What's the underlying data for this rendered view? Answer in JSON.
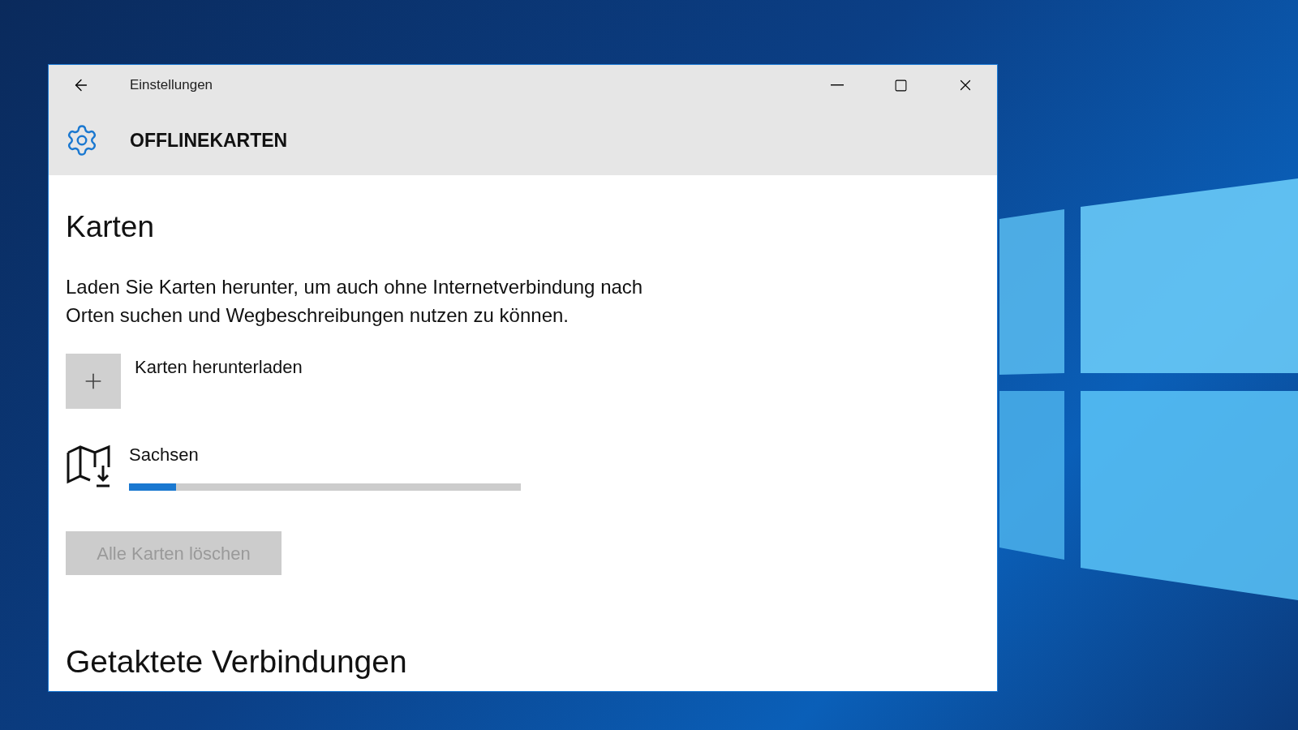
{
  "window": {
    "title": "Einstellungen",
    "page_title": "OFFLINEKARTEN"
  },
  "section": {
    "heading": "Karten",
    "description_lines": [
      "Laden Sie Karten herunter, um auch ohne Internetverbindung nach",
      "Orten suchen und Wegbeschreibungen nutzen zu können."
    ],
    "add_label": "Karten herunterladen",
    "downloads": [
      {
        "name": "Sachsen",
        "level": 0.12
      }
    ],
    "delete_button": {
      "label": "Alle Karten löschen",
      "disabled": true
    }
  },
  "next_section": {
    "heading": "Getaktete Verbindungen"
  }
}
